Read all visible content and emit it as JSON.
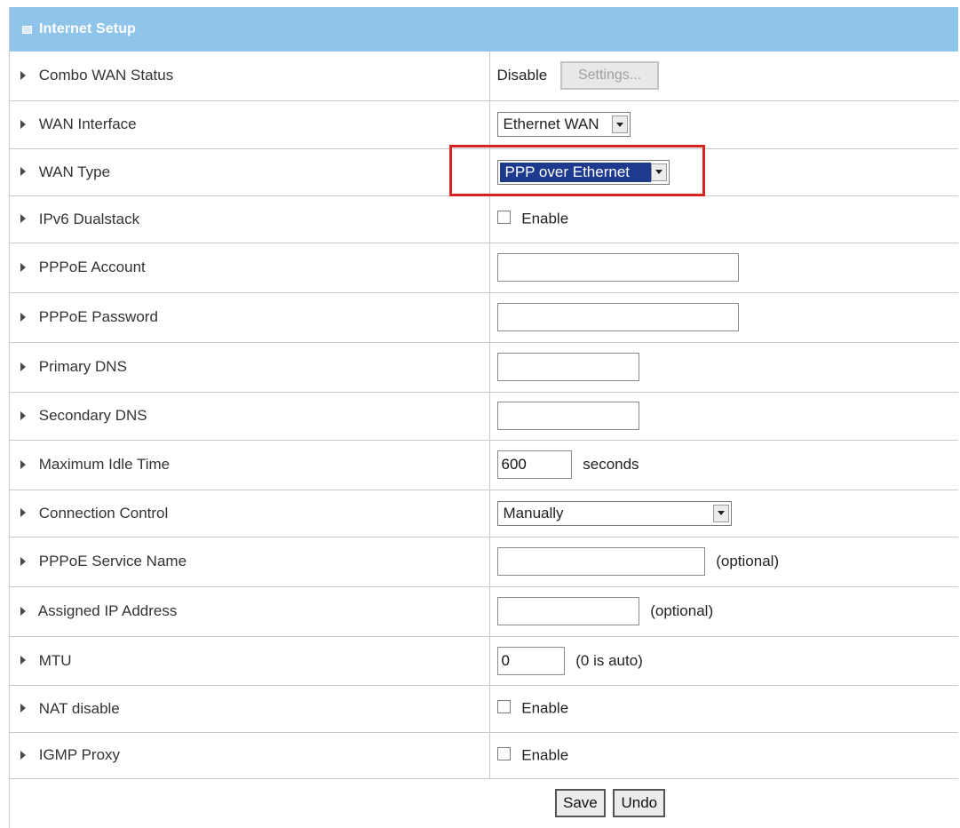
{
  "header": {
    "title": "Internet Setup"
  },
  "rows": {
    "combo_wan_status": {
      "label": "Combo WAN Status",
      "value": "Disable",
      "button": "Settings..."
    },
    "wan_interface": {
      "label": "WAN Interface",
      "selected": "Ethernet WAN"
    },
    "wan_type": {
      "label": "WAN Type",
      "selected": "PPP over Ethernet"
    },
    "ipv6_dualstack": {
      "label": "IPv6 Dualstack",
      "checkbox_label": "Enable",
      "checked": false
    },
    "pppoe_account": {
      "label": "PPPoE Account",
      "value": ""
    },
    "pppoe_password": {
      "label": "PPPoE Password",
      "value": ""
    },
    "primary_dns": {
      "label": "Primary DNS",
      "value": ""
    },
    "secondary_dns": {
      "label": "Secondary DNS",
      "value": ""
    },
    "max_idle_time": {
      "label": "Maximum Idle Time",
      "value": "600",
      "suffix": "seconds"
    },
    "connection_control": {
      "label": "Connection Control",
      "selected": "Manually"
    },
    "pppoe_service_name": {
      "label": "PPPoE Service Name",
      "value": "",
      "suffix": "(optional)"
    },
    "assigned_ip": {
      "label": "Assigned IP Address",
      "value": "",
      "suffix": "(optional)"
    },
    "mtu": {
      "label": "MTU",
      "value": "0",
      "suffix": "(0 is auto)"
    },
    "nat_disable": {
      "label": "NAT disable",
      "checkbox_label": "Enable",
      "checked": false
    },
    "igmp_proxy": {
      "label": "IGMP Proxy",
      "checkbox_label": "Enable",
      "checked": false
    }
  },
  "actions": {
    "save_label": "Save",
    "undo_label": "Undo"
  },
  "colors": {
    "header_bg": "#8fc4eb",
    "highlight_bg": "#1d3a8f",
    "annotation_red": "#d92323"
  }
}
